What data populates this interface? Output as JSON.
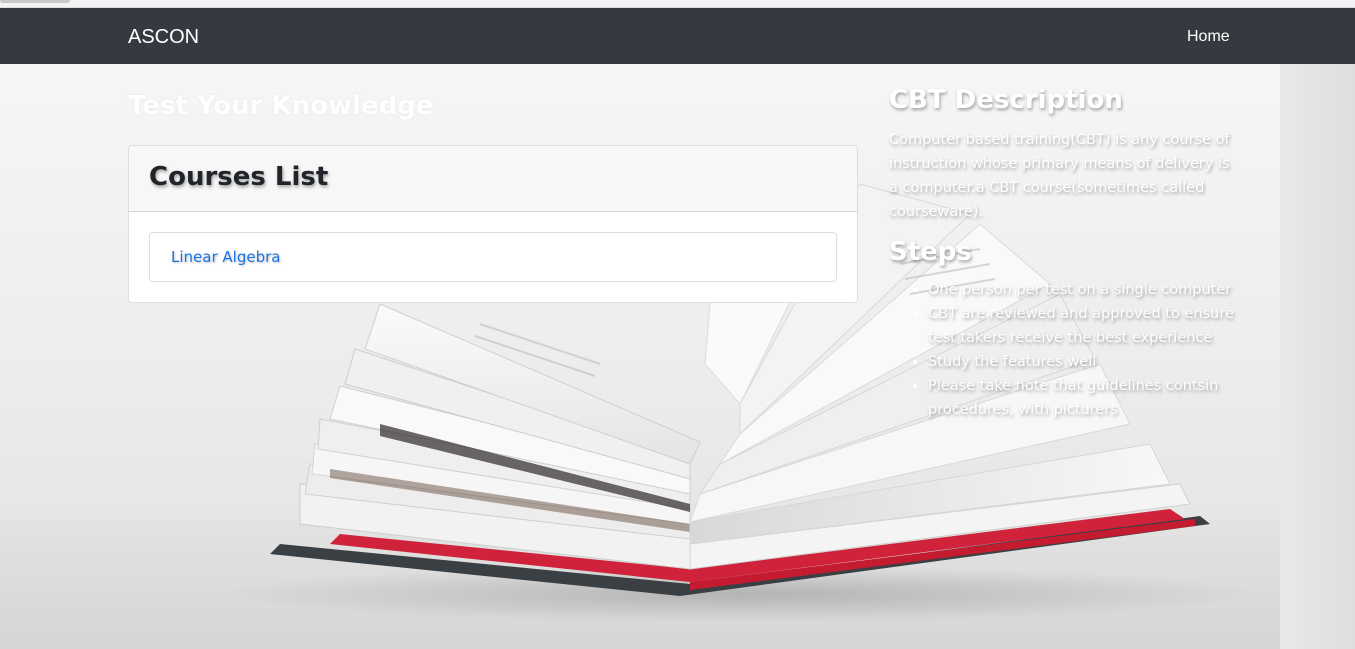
{
  "navbar": {
    "brand": "ASCON",
    "home_label": "Home"
  },
  "main": {
    "section_title": "Test Your Knowledge",
    "courses_card": {
      "title": "Courses List",
      "courses": [
        {
          "label": "Linear Algebra"
        }
      ]
    }
  },
  "sidebar": {
    "description_title": "CBT Description",
    "description_text": "Computer based training(CBT) is any course of instruction whose primary means of delivery is a computer.a CBT course(sometimes called courseware).",
    "steps_title": "Steps",
    "steps": [
      "One person per test on a single computer",
      "CBT are reviewed and approved to ensure test takers receive the best experience",
      "Study the features well",
      "Please take note that guidelines contsin procedures, with picturers"
    ]
  },
  "colors": {
    "navbar_bg": "#343a40",
    "link": "#1a73e8",
    "book_cover_red": "#d0223a"
  },
  "icons": {
    "background": "open-book-photo-icon"
  }
}
